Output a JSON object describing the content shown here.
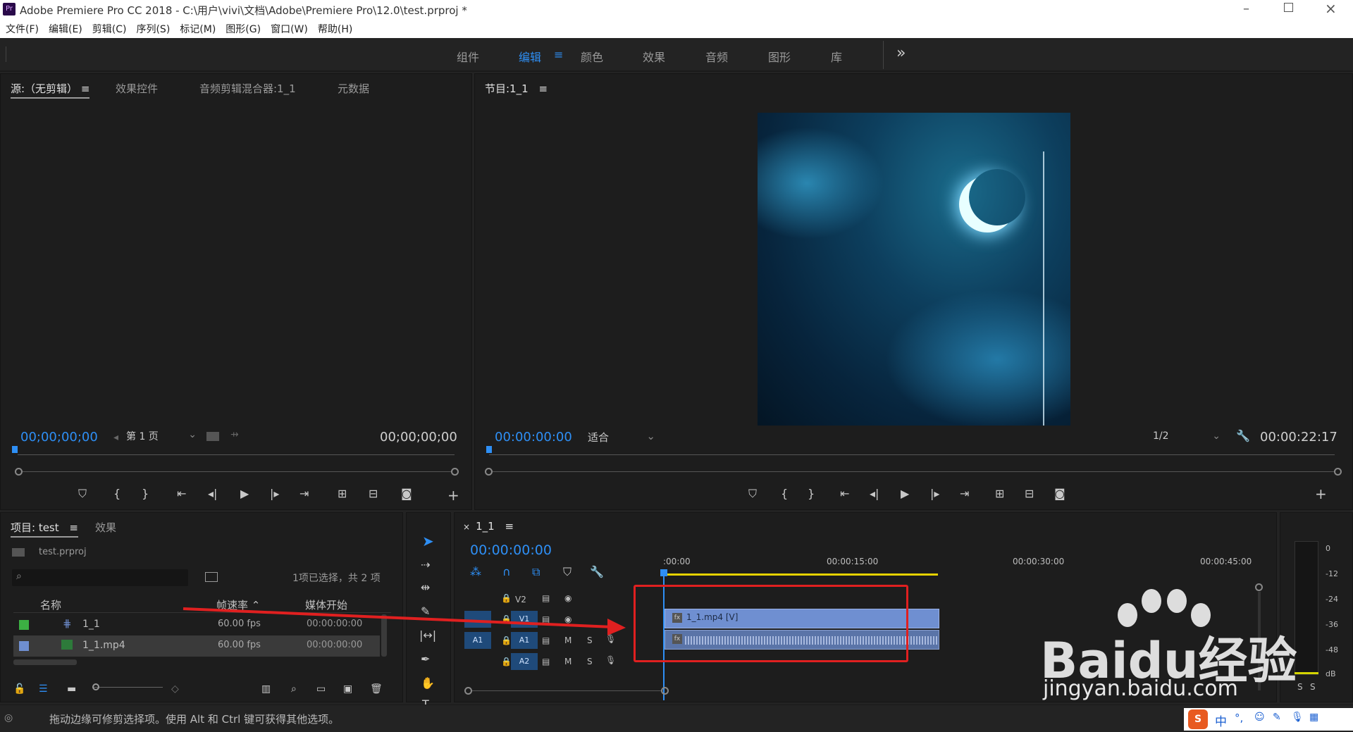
{
  "window": {
    "app_icon": "Pr",
    "title": "Adobe Premiere Pro CC 2018 - C:\\用户\\vivi\\文档\\Adobe\\Premiere Pro\\12.0\\test.prproj *"
  },
  "menu": [
    "文件(F)",
    "编辑(E)",
    "剪辑(C)",
    "序列(S)",
    "标记(M)",
    "图形(G)",
    "窗口(W)",
    "帮助(H)"
  ],
  "workspaces": [
    "组件",
    "编辑",
    "颜色",
    "效果",
    "音频",
    "图形",
    "库"
  ],
  "active_workspace": "编辑",
  "more_label": "»",
  "menu_glyph": "≡",
  "source": {
    "tabs": [
      "源:（无剪辑）",
      "效果控件",
      "音频剪辑混合器:1_1",
      "元数据"
    ],
    "timecode_left": "00;00;00;00",
    "page_label": "第 1 页",
    "timecode_right": "00;00;00;00"
  },
  "program": {
    "tab": "节目:1_1",
    "timecode": "00:00:00:00",
    "fit_label": "适合",
    "resolution": "1/2",
    "duration": "00:00:22:17"
  },
  "project": {
    "tabs": [
      "项目: test",
      "效果"
    ],
    "file": "test.prproj",
    "selection_info": "1项已选择，共 2 项",
    "columns": [
      "名称",
      "帧速率",
      "媒体开始"
    ],
    "rows": [
      {
        "name": "1_1",
        "fps": "60.00 fps",
        "start": "00:00:00:00",
        "color": "#3cb043"
      },
      {
        "name": "1_1.mp4",
        "fps": "60.00 fps",
        "start": "00:00:00:00",
        "color": "#6f8fd1"
      }
    ]
  },
  "timeline": {
    "tab": "1_1",
    "close_glyph": "×",
    "timecode": "00:00:00:00",
    "ruler_labels": [
      ":00:00",
      "00:00:15:00",
      "00:00:30:00",
      "00:00:45:00"
    ],
    "tracks": [
      {
        "id": "V2",
        "type": "video"
      },
      {
        "id": "V1",
        "type": "video"
      },
      {
        "id": "A1",
        "type": "audio"
      },
      {
        "id": "A2",
        "type": "audio"
      }
    ],
    "video_clip": "1_1.mp4 [V]",
    "track_m": "M",
    "track_s": "S"
  },
  "meter": {
    "labels": [
      "0",
      "-12",
      "-24",
      "-36",
      "-48",
      "dB"
    ],
    "solo": [
      "S",
      "S"
    ]
  },
  "status": "拖动边缘可修剪选择项。使用 Alt 和 Ctrl 键可获得其他选项。",
  "watermark": {
    "brand": "Baidu经验",
    "url": "jingyan.baidu.com"
  },
  "ime": {
    "label": "中",
    "punct": "°,"
  },
  "colors": {
    "accent": "#2e8ff5",
    "clip_video": "#6f8fd1",
    "annotation": "#e02020"
  }
}
